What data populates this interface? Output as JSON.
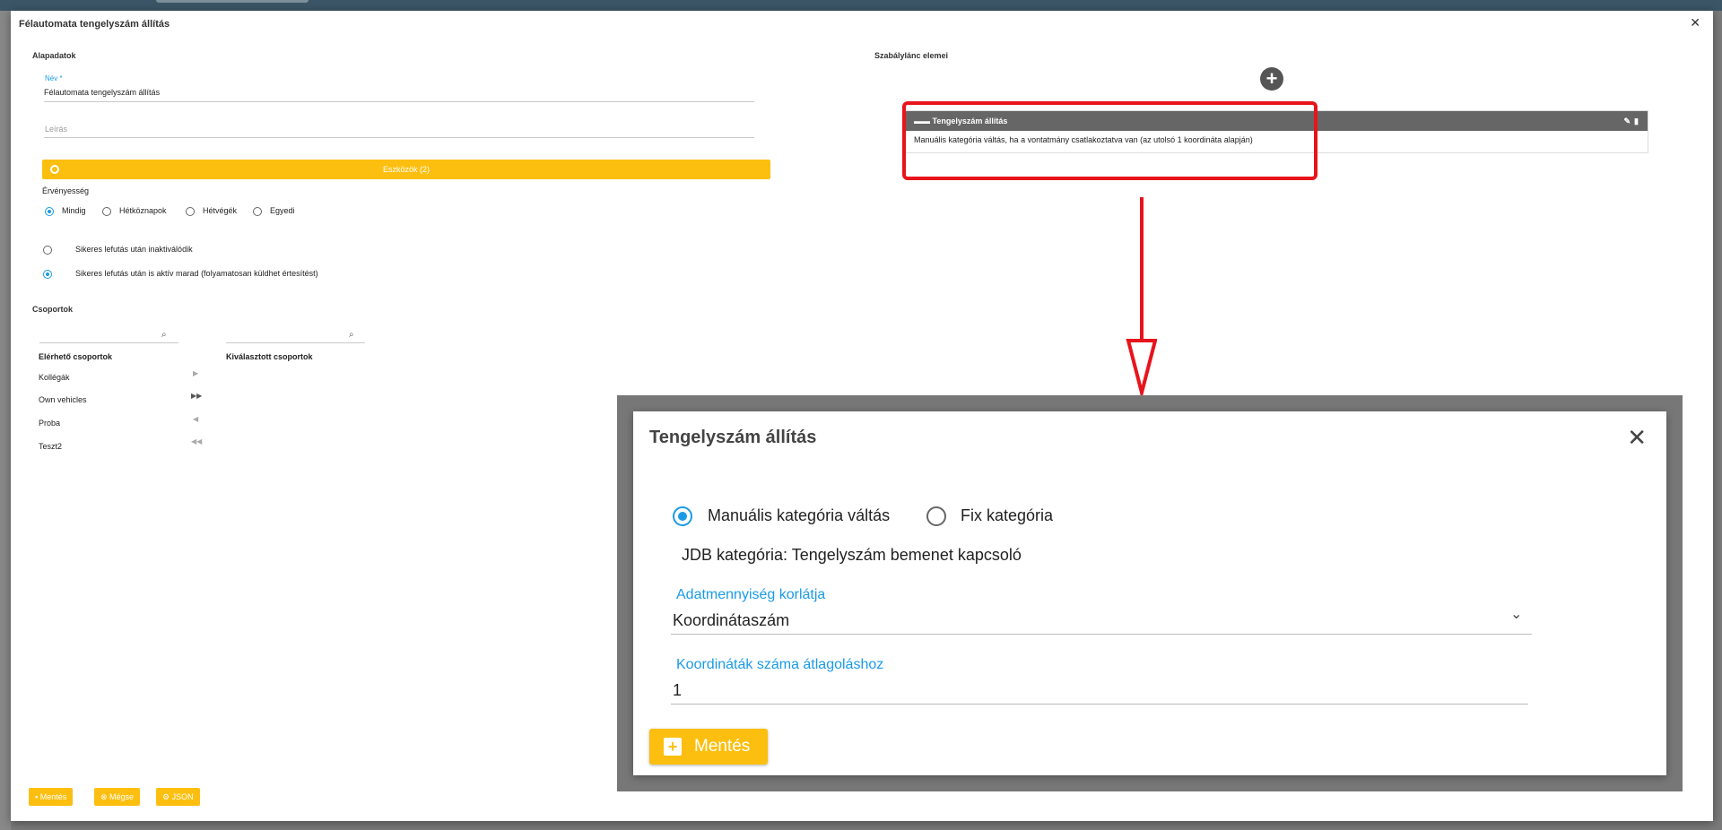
{
  "dialog": {
    "title": "Félautomata tengelyszám állítás"
  },
  "basic": {
    "section_title": "Alapadatok",
    "name_label": "Név *",
    "name_value": "Félautomata tengelyszám állítás",
    "description_placeholder": "Leírás",
    "tools_button": "Eszközök (2)",
    "validity_label": "Érvényesség",
    "validity_options": [
      "Mindig",
      "Hétköznapok",
      "Hétvégék",
      "Egyedi"
    ],
    "validity_selected": "Mindig",
    "after_run_options": [
      "Sikeres lefutás után inaktiválódik",
      "Sikeres lefutás után is aktív marad (folyamatosan küldhet értesítést)"
    ],
    "after_run_selected": 1
  },
  "groups": {
    "section_title": "Csoportok",
    "available_title": "Elérhető csoportok",
    "selected_title": "Kiválasztott csoportok",
    "available": [
      "Kollégák",
      "Own vehicles",
      "Proba",
      "Teszt2"
    ]
  },
  "footer": {
    "save": "Mentés",
    "cancel": "Mégse",
    "json": "JSON"
  },
  "rules": {
    "section_title": "Szabálylánc elemei",
    "card_title": "Tengelyszám állítás",
    "card_body": "Manuális kategória váltás, ha a vontatmány csatlakoztatva van (az utolsó 1 koordináta alapján)"
  },
  "zoom_modal": {
    "title": "Tengelyszám állítás",
    "radio_options": [
      "Manuális kategória váltás",
      "Fix kategória"
    ],
    "radio_selected": 0,
    "jdb_text": "JDB kategória: Tengelyszám bemenet kapcsoló",
    "limit_label": "Adatmennyiség korlátja",
    "limit_value": "Koordinátaszám",
    "coords_label": "Koordináták száma átlagoláshoz",
    "coords_value": "1",
    "save_button": "Mentés"
  },
  "colors": {
    "accent": "#fcbf10",
    "link": "#1a9be6",
    "highlight": "#e8141b"
  }
}
